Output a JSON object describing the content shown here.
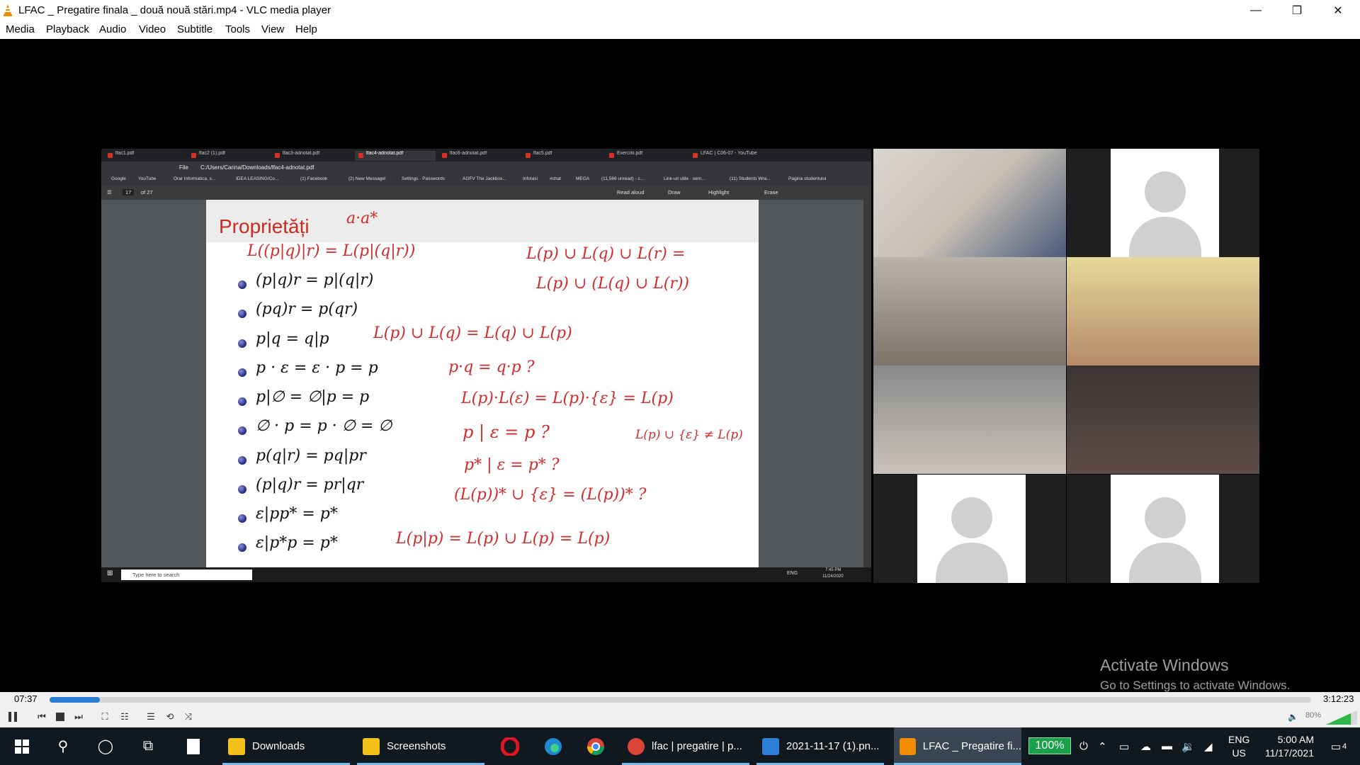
{
  "window": {
    "title": "LFAC _ Pregatire finala _ două nouă stări.mp4 - VLC media player",
    "minimize": "—",
    "restore": "❐",
    "close": "✕"
  },
  "menu": [
    "Media",
    "Playback",
    "Audio",
    "Video",
    "Subtitle",
    "Tools",
    "View",
    "Help"
  ],
  "shared_screen": {
    "tabs": [
      "lfac1.pdf",
      "lfac2 (1).pdf",
      "lfac3-adnotat.pdf",
      "lfac4-adnotat.pdf",
      "lfac6-adnotat.pdf",
      "lfac5.pdf",
      "Exercitii.pdf",
      "LFAC | C06-07 - YouTube"
    ],
    "address": "C:/Users/Carina/Downloads/lfac4-adnotat.pdf",
    "file_label": "File",
    "bookmarks": [
      "Google",
      "YouTube",
      "Orar Informatica, s...",
      "IDEA LEASING/Co...",
      "(1) Facebook",
      "(2) New Message!",
      "Settings · Passwords",
      "AGFV The Jackbox...",
      "InfoIasi",
      "#chat",
      "MEGA",
      "(11,566 unread) - c...",
      "Link-uri utile · sem...",
      "(11) Students Wra...",
      "Pagina studentului"
    ],
    "pdf_toolbar": {
      "page": "17",
      "of": "of 27",
      "read_aloud": "Read aloud",
      "draw": "Draw",
      "highlight": "Highlight",
      "erase": "Erase"
    },
    "slide": {
      "heading": "Proprietăți",
      "formulas": [
        "(p|q)r = p|(q|r)",
        "(pq)r = p(qr)",
        "p|q = q|p",
        "p · ε = ε · p = p",
        "p|∅ = ∅|p = p",
        "∅ · p = p · ∅ = ∅",
        "p(q|r) = pq|pr",
        "(p|q)r = pr|qr",
        "ε|pp* = p*",
        "ε|p*p = p*"
      ],
      "handwriting": [
        "a·a*",
        "L((p|q)|r) = L(p|(q|r))",
        "L(p) ∪ L(q) ∪ L(r) =",
        "L(p) ∪ (L(q) ∪ L(r))",
        "L(p) ∪ L(q) = L(q) ∪ L(p)",
        "p·q = q·p ?",
        "L(p)·L(ε) = L(p)·{ε} = L(p)",
        "p | ε = p ?",
        "L(p) ∪ {ε} ≠ L(p)",
        "p* | ε = p* ?",
        "(L(p))* ∪ {ε} = (L(p))* ?",
        "L(p|p) = L(p) ∪ L(p) = L(p)"
      ]
    },
    "taskbar_search": "Type here to search",
    "tray_time": "7:45 PM",
    "tray_date": "11/24/2020",
    "tray_lang": "ENG"
  },
  "watermark": {
    "title": "Activate Windows",
    "subtitle": "Go to Settings to activate Windows."
  },
  "player": {
    "elapsed": "07:37",
    "total": "3:12:23",
    "progress": 0.04,
    "volume_label": "80%",
    "volume": 0.8
  },
  "taskbar": {
    "apps": [
      {
        "label": "Downloads",
        "color": "#f2c21b"
      },
      {
        "label": "Screenshots",
        "color": "#f2c21b"
      },
      {
        "label": "lfac | pregatire | p...",
        "color": "#db4437"
      },
      {
        "label": "2021-11-17 (1).pn...",
        "color": "#2f7fd8"
      },
      {
        "label": "LFAC _ Pregatire fi...",
        "color": "#f08c00"
      }
    ],
    "battery": "100%",
    "lang_top": "ENG",
    "lang_bottom": "US",
    "time": "5:00 AM",
    "date": "11/17/2021",
    "notifications": "4"
  }
}
